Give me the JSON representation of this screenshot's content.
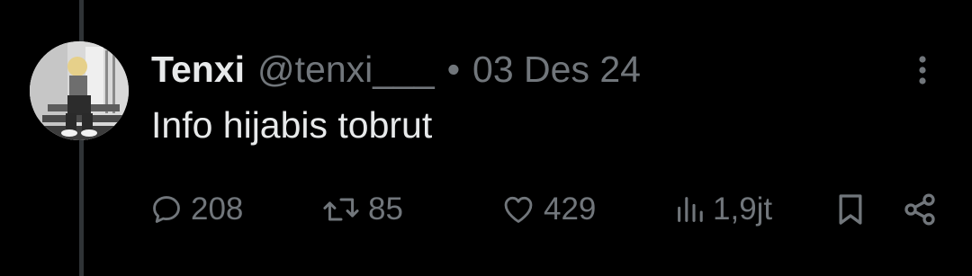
{
  "tweet": {
    "author": {
      "display_name": "Tenxi",
      "handle": "@tenxi___"
    },
    "separator": "•",
    "date": "03 Des 24",
    "text": "Info hijabis tobrut",
    "actions": {
      "replies": "208",
      "retweets": "85",
      "likes": "429",
      "views": "1,9jt"
    }
  },
  "icons": {
    "more": "more-vertical-icon",
    "reply": "reply-icon",
    "retweet": "retweet-icon",
    "like": "heart-icon",
    "views": "views-chart-icon",
    "bookmark": "bookmark-icon",
    "share": "share-icon"
  },
  "colors": {
    "background": "#000000",
    "primary_text": "#e7e9ea",
    "secondary_text": "#71767b",
    "thread_line": "#2f3336"
  }
}
